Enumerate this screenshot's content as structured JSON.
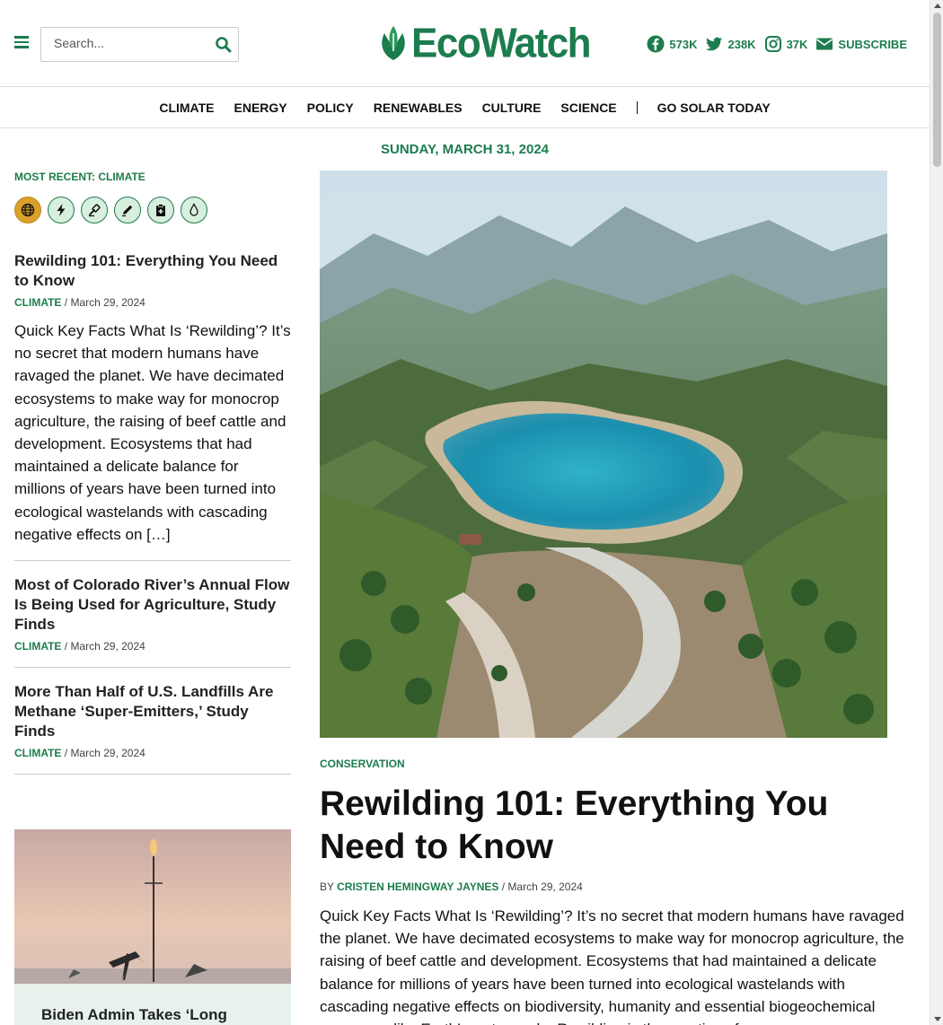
{
  "header": {
    "search_placeholder": "Search...",
    "logo_text": "EcoWatch",
    "social": {
      "facebook": "573K",
      "twitter": "238K",
      "instagram": "37K",
      "subscribe": "SUBSCRIBE"
    }
  },
  "nav": {
    "items": [
      "CLIMATE",
      "ENERGY",
      "POLICY",
      "RENEWABLES",
      "CULTURE",
      "SCIENCE"
    ],
    "cta": "GO SOLAR TODAY"
  },
  "date": "SUNDAY, MARCH 31, 2024",
  "sidebar": {
    "heading": "MOST RECENT: CLIMATE",
    "category_icons": [
      "globe-icon",
      "lightning-icon",
      "gavel-icon",
      "pencil-icon",
      "clipboard-icon",
      "water-drop-icon"
    ],
    "items": [
      {
        "title": "Rewilding 101: Everything You Need to Know",
        "category": "CLIMATE",
        "date": " / March 29, 2024",
        "excerpt": "Quick Key Facts What Is ‘Rewilding’? It’s no secret that modern humans have ravaged the planet. We have decimated ecosystems to make way for monocrop agriculture, the raising of beef cattle and development. Ecosystems that had maintained a delicate balance for millions of years have been turned into ecological wastelands with cascading negative effects on […]"
      },
      {
        "title": "Most of Colorado River’s Annual Flow Is Being Used for Agriculture, Study Finds",
        "category": "CLIMATE",
        "date": " / March 29, 2024"
      },
      {
        "title": "More Than Half of U.S. Landfills Are Methane ‘Super-Emitters,’ Study Finds",
        "category": "CLIMATE",
        "date": " / March 29, 2024"
      }
    ],
    "card_title": "Biden Admin Takes ‘Long"
  },
  "featured": {
    "category": "CONSERVATION",
    "title": "Rewilding 101: Everything You Need to Know",
    "by": "BY ",
    "author": "CRISTEN HEMINGWAY JAYNES",
    "date": " / March 29, 2024",
    "excerpt": "Quick Key Facts What Is ‘Rewilding’? It’s no secret that modern humans have ravaged the planet. We have decimated ecosystems to make way for monocrop agriculture, the raising of beef cattle and development. Ecosystems that had maintained a delicate balance for millions of years have been turned into ecological wastelands with cascading negative effects on biodiversity, humanity and essential biogeochemical processes like Earth’s water cycle. Rewilding is the practice of"
  },
  "colors": {
    "brand_green": "#1c7c4d",
    "active_icon": "#d9a02b"
  }
}
